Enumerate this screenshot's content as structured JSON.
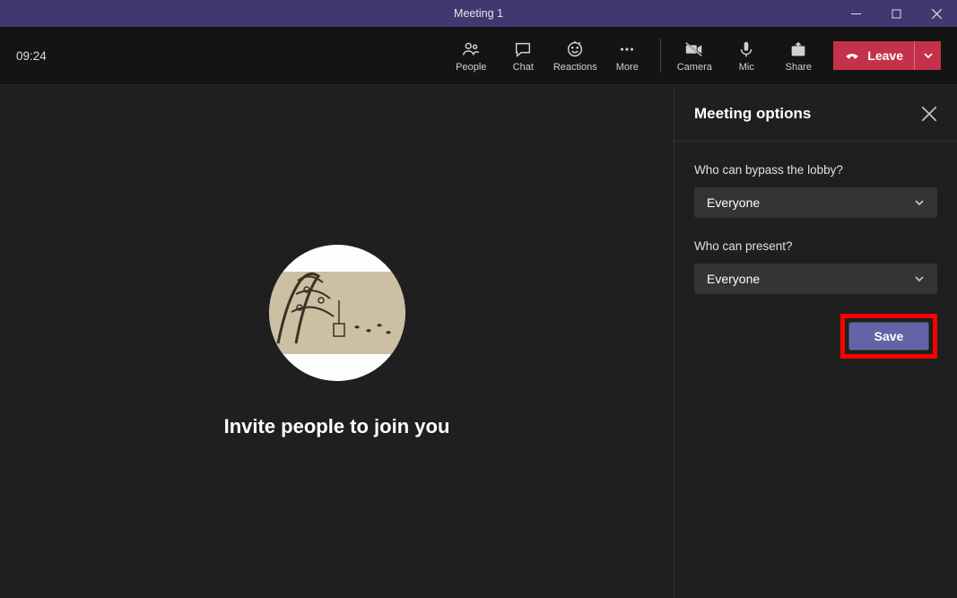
{
  "window": {
    "title": "Meeting 1"
  },
  "toolbar": {
    "time": "09:24",
    "people": "People",
    "chat": "Chat",
    "reactions": "Reactions",
    "more": "More",
    "camera": "Camera",
    "mic": "Mic",
    "share": "Share",
    "leave": "Leave"
  },
  "stage": {
    "invite": "Invite people to join you"
  },
  "panel": {
    "title": "Meeting options",
    "lobby_label": "Who can bypass the lobby?",
    "lobby_value": "Everyone",
    "present_label": "Who can present?",
    "present_value": "Everyone",
    "save": "Save"
  }
}
